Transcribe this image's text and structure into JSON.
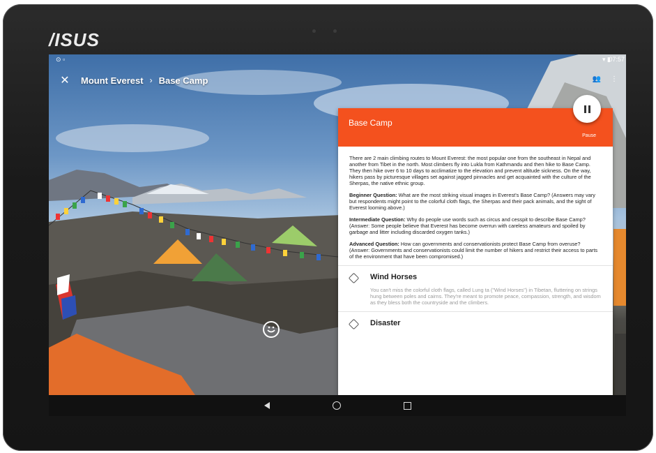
{
  "device": {
    "brand": "/ISUS"
  },
  "status": {
    "time": "07:57"
  },
  "breadcrumb": {
    "root": "Mount Everest",
    "current": "Base Camp"
  },
  "panel": {
    "title": "Base Camp",
    "pause_label": "Pause",
    "intro": "There are 2 main climbing routes to Mount Everest: the most popular one from the southeast in Nepal and another from Tibet in the north. Most climbers fly into Lukla from Kathmandu and then hike to Base Camp. They then hike over 6 to 10 days to acclimatize to the elevation and prevent altitude sickness. On the way, hikers pass by picturesque villages set against jagged pinnacles and get acquainted with the culture of the Sherpas, the native ethnic group.",
    "questions": [
      {
        "label": "Beginner Question:",
        "text": " What are the most striking visual images in Everest's Base Camp? (Answers may vary but respondents might point to the colorful cloth flags, the Sherpas and their pack animals, and the sight of Everest looming above.)"
      },
      {
        "label": "Intermediate Question:",
        "text": " Why do people use words such as circus and cesspit to describe Base Camp? (Answer: Some people believe that Everest has become overrun with careless amateurs and spoiled by garbage and litter including discarded oxygen tanks.)"
      },
      {
        "label": "Advanced Question:",
        "text": " How can governments and conservationists protect Base Camp from overuse? (Answer: Governments and conservationists could limit the number of hikers and restrict their access to parts of the environment that have been compromised.)"
      }
    ],
    "items": [
      {
        "title": "Wind Horses",
        "desc": "You can't miss the colorful cloth flags, called Lung ta (\"Wind Horses\") in Tibetan, fluttering on strings hung between poles and cairns. They're meant to promote peace, compassion, strength, and wisdom as they bless both the countryside and the climbers."
      },
      {
        "title": "Disaster",
        "desc": ""
      }
    ]
  }
}
